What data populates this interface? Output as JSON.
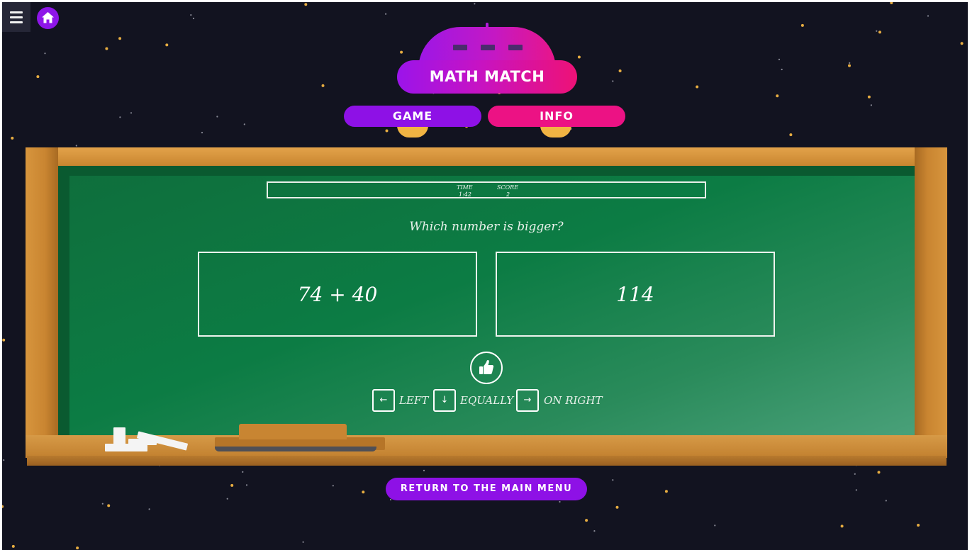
{
  "app": {
    "title": "MATH MATCH",
    "menu_icon": "hamburger-menu-icon",
    "home_icon": "home-icon"
  },
  "nav": {
    "tabs": [
      {
        "label": "GAME",
        "active": true
      },
      {
        "label": "INFO",
        "active": false
      }
    ]
  },
  "game": {
    "time_label": "TIME",
    "time_value": "1:42",
    "score_label": "SCORE",
    "score_value": "2",
    "question": "Which number is bigger?",
    "left_expression": "74 + 40",
    "right_expression": "114",
    "feedback_icon": "thumbs-up-icon",
    "controls": [
      {
        "key": "←",
        "label": "LEFT"
      },
      {
        "key": "↓",
        "label": "EQUALLY"
      },
      {
        "key": "→",
        "label": "ON RIGHT"
      }
    ]
  },
  "footer": {
    "return_label": "RETURN TO THE MAIN MENU"
  },
  "colors": {
    "background": "#121320",
    "purple": "#8e11e6",
    "pink": "#ec1284",
    "board_green": "#0c7c44",
    "wood": "#c98531",
    "star": "#f2b443"
  }
}
